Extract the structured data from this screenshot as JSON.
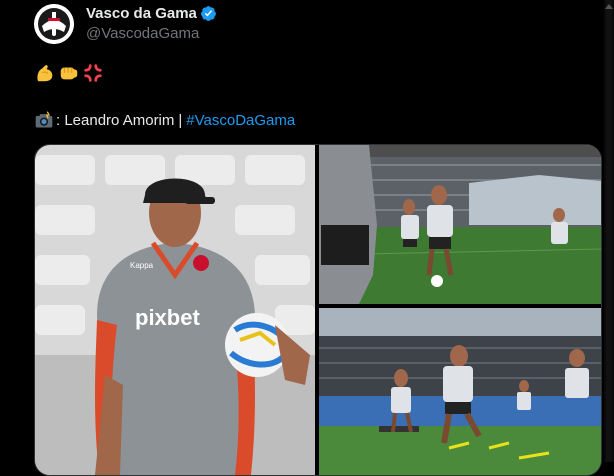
{
  "author": {
    "display_name": "Vasco da Gama",
    "handle": "@VascodaGama",
    "verified": true,
    "verified_color": "#1d9bf0"
  },
  "post": {
    "emoji_line": [
      "flexed-biceps-icon",
      "oncoming-fist-icon",
      "anger-symbol-icon"
    ],
    "caption_icon": "camera-with-flash-icon",
    "caption": ": Leandro Amorim",
    "separator": "|",
    "hashtag": "#VascoDaGama"
  },
  "media": {
    "main_photo": {
      "subject": "coach-photo",
      "shirt_text": "pixbet",
      "logo_text": "Kappa"
    },
    "top_right_photo": {
      "subject": "training-photo-1"
    },
    "bottom_right_photo": {
      "subject": "training-photo-2"
    }
  },
  "colors": {
    "background": "#000000",
    "text": "#e7e9ea",
    "secondary": "#71767b",
    "link": "#1d9bf0"
  }
}
